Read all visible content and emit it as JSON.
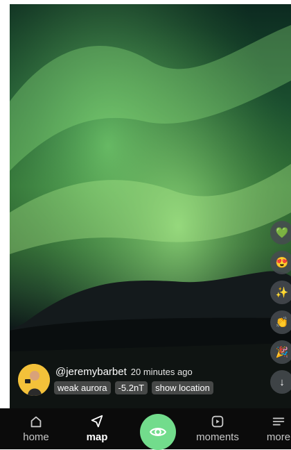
{
  "post": {
    "username": "@jeremybarbet",
    "time_ago": "20 minutes ago",
    "tags": [
      "weak aurora",
      "-5.2nT",
      "show location"
    ]
  },
  "reactions": [
    "💚",
    "😍",
    "✨",
    "👏",
    "🎉",
    "↓"
  ],
  "nav": {
    "items": [
      "home",
      "map",
      "moments",
      "more"
    ],
    "active": "map",
    "accent_color": "#72dc8c"
  }
}
